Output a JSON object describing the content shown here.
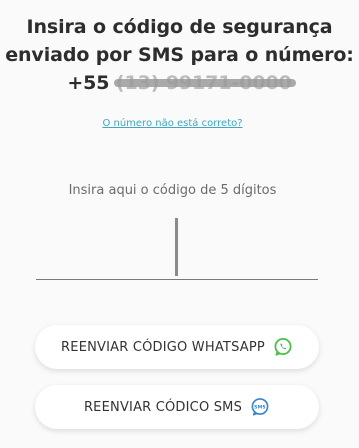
{
  "header": {
    "line1": "Insira o código de segurança",
    "line2": "enviado por SMS para o número:",
    "phone_prefix": "+55",
    "phone_masked": "(13) 99171-0000"
  },
  "wrong_number_link": "O número não está correto?",
  "code_entry": {
    "label": "Insira aqui o código de 5 dígitos",
    "value": ""
  },
  "buttons": {
    "whatsapp_label": "REENVIAR CÓDIGO WHATSAPP",
    "sms_label": "REENVIAR CÓDICO SMS"
  },
  "icons": {
    "whatsapp": "whatsapp-icon",
    "sms": "sms-chat-icon"
  },
  "colors": {
    "whatsapp_green": "#4cc04a",
    "sms_blue": "#3a82c9",
    "link_blue": "#3fa7c2"
  }
}
